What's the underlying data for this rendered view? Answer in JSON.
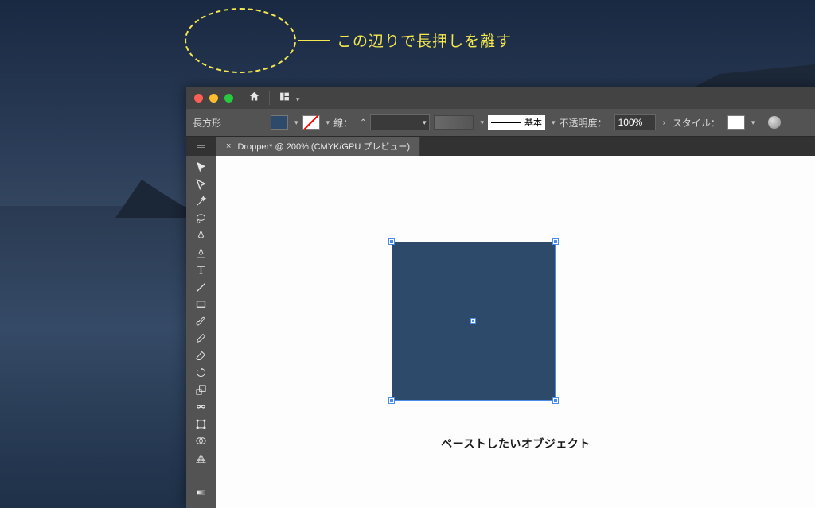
{
  "annotation": {
    "text": "この辺りで長押しを離す"
  },
  "titlebar": {
    "traffic": [
      "close",
      "minimize",
      "zoom"
    ]
  },
  "control_bar": {
    "shape_label": "長方形",
    "stroke_label": "線：",
    "profile_label": "基本",
    "opacity_label": "不透明度：",
    "opacity_value": "100%",
    "style_label": "スタイル："
  },
  "tab": {
    "title": "Dropper* @ 200% (CMYK/GPU プレビュー)"
  },
  "tools": [
    {
      "name": "selection-tool"
    },
    {
      "name": "direct-selection-tool"
    },
    {
      "name": "magic-wand-tool"
    },
    {
      "name": "lasso-tool"
    },
    {
      "name": "pen-tool"
    },
    {
      "name": "curvature-tool"
    },
    {
      "name": "type-tool"
    },
    {
      "name": "line-tool"
    },
    {
      "name": "rectangle-tool"
    },
    {
      "name": "brush-tool"
    },
    {
      "name": "pencil-tool"
    },
    {
      "name": "eraser-tool"
    },
    {
      "name": "rotate-tool"
    },
    {
      "name": "scale-tool"
    },
    {
      "name": "width-tool"
    },
    {
      "name": "free-transform-tool"
    },
    {
      "name": "shape-builder-tool"
    },
    {
      "name": "perspective-grid-tool"
    },
    {
      "name": "mesh-tool"
    },
    {
      "name": "gradient-tool"
    }
  ],
  "canvas": {
    "caption": "ペーストしたいオブジェクト",
    "object": {
      "type": "rectangle",
      "fill": "#2e4a6b",
      "selected": true
    }
  }
}
